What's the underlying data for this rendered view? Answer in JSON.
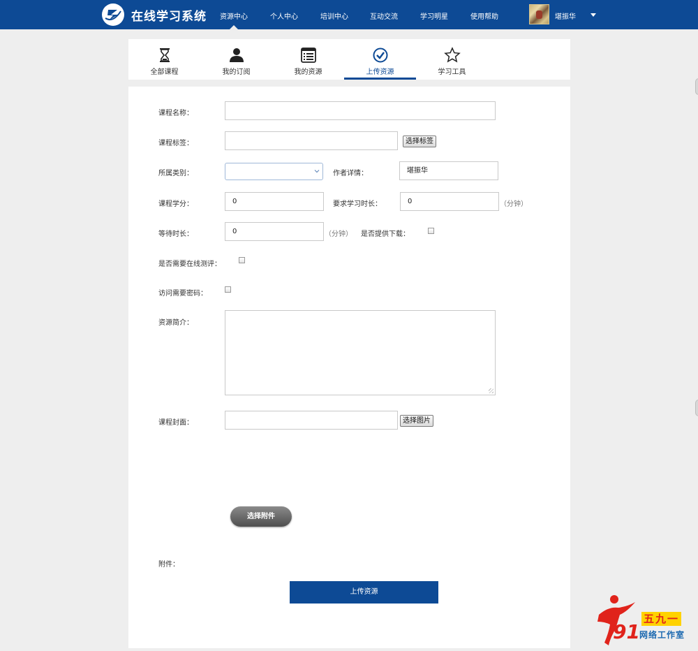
{
  "header": {
    "app_title": "在线学习系统",
    "nav": [
      "资源中心",
      "个人中心",
      "培训中心",
      "互动交流",
      "学习明星",
      "使用帮助"
    ],
    "active_nav_index": 0,
    "username": "堪振华",
    "brand_color": "#0d4a95"
  },
  "tabs": [
    {
      "label": "全部课程",
      "icon": "hourglass-icon"
    },
    {
      "label": "我的订阅",
      "icon": "user-icon"
    },
    {
      "label": "我的资源",
      "icon": "list-icon"
    },
    {
      "label": "上传资源",
      "icon": "check-circle-icon"
    },
    {
      "label": "学习工具",
      "icon": "star-icon"
    }
  ],
  "active_tab_index": 3,
  "form": {
    "course_name": {
      "label": "课程名称：",
      "value": ""
    },
    "course_tags": {
      "label": "课程标签：",
      "value": "",
      "button": "选择标签"
    },
    "category": {
      "label": "所属类别：",
      "selected": ""
    },
    "author": {
      "label": "作者详情：",
      "value": "堪振华"
    },
    "credit": {
      "label": "课程学分：",
      "value": "0"
    },
    "required_time": {
      "label": "要求学习时长：",
      "value": "0",
      "unit": "（分钟）"
    },
    "wait_time": {
      "label": "等待时长：",
      "value": "0",
      "unit": "（分钟）"
    },
    "download": {
      "label": "是否提供下载：",
      "checked": false
    },
    "online_eval": {
      "label": "是否需要在线测评：",
      "checked": false
    },
    "password": {
      "label": "访问需要密码：",
      "checked": false
    },
    "intro": {
      "label": "资源简介：",
      "value": ""
    },
    "cover": {
      "label": "课程封面：",
      "value": "",
      "button": "选择图片"
    },
    "attach_button": "选择附件",
    "attachment": {
      "label": "附件："
    },
    "submit": "上传资源"
  },
  "watermark": {
    "number": "91",
    "top": "五九一",
    "bottom": "网络工作室"
  }
}
